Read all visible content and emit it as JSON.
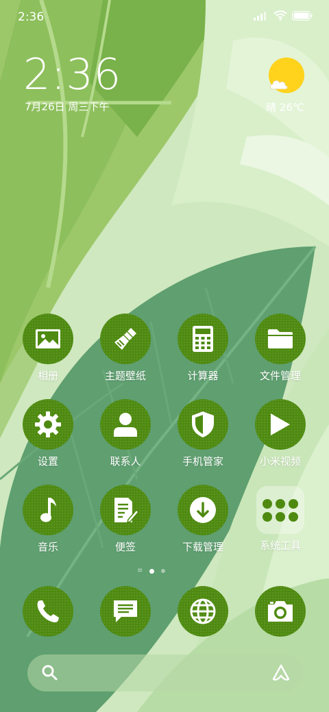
{
  "status_bar": {
    "time": "2:36"
  },
  "clock": {
    "time": "2:36",
    "date": "7月26日 周三下午"
  },
  "weather": {
    "text": "晴 26℃",
    "icon": "sun-cloud-icon"
  },
  "apps": [
    {
      "label": "相册",
      "icon": "gallery-icon"
    },
    {
      "label": "主题壁纸",
      "icon": "brush-icon"
    },
    {
      "label": "计算器",
      "icon": "calculator-icon"
    },
    {
      "label": "文件管理",
      "icon": "folder-icon"
    },
    {
      "label": "设置",
      "icon": "gear-icon"
    },
    {
      "label": "联系人",
      "icon": "person-icon"
    },
    {
      "label": "手机管家",
      "icon": "shield-icon"
    },
    {
      "label": "小米视频",
      "icon": "play-icon"
    },
    {
      "label": "音乐",
      "icon": "music-note-icon"
    },
    {
      "label": "便签",
      "icon": "notes-icon"
    },
    {
      "label": "下载管理",
      "icon": "download-icon"
    },
    {
      "label": "系统工具",
      "icon": "folder-grid-icon"
    }
  ],
  "dock": [
    {
      "icon": "phone-icon"
    },
    {
      "icon": "message-icon"
    },
    {
      "icon": "browser-globe-icon"
    },
    {
      "icon": "camera-icon"
    }
  ],
  "colors": {
    "icon_bg": "#4e8a10",
    "sun": "#ffd21c",
    "wallpaper_light": "#d4ebc4",
    "wallpaper_leaf": "#5e9e6f"
  },
  "pager": {
    "active_index": 1,
    "count": 2
  },
  "search": {
    "placeholder": ""
  }
}
